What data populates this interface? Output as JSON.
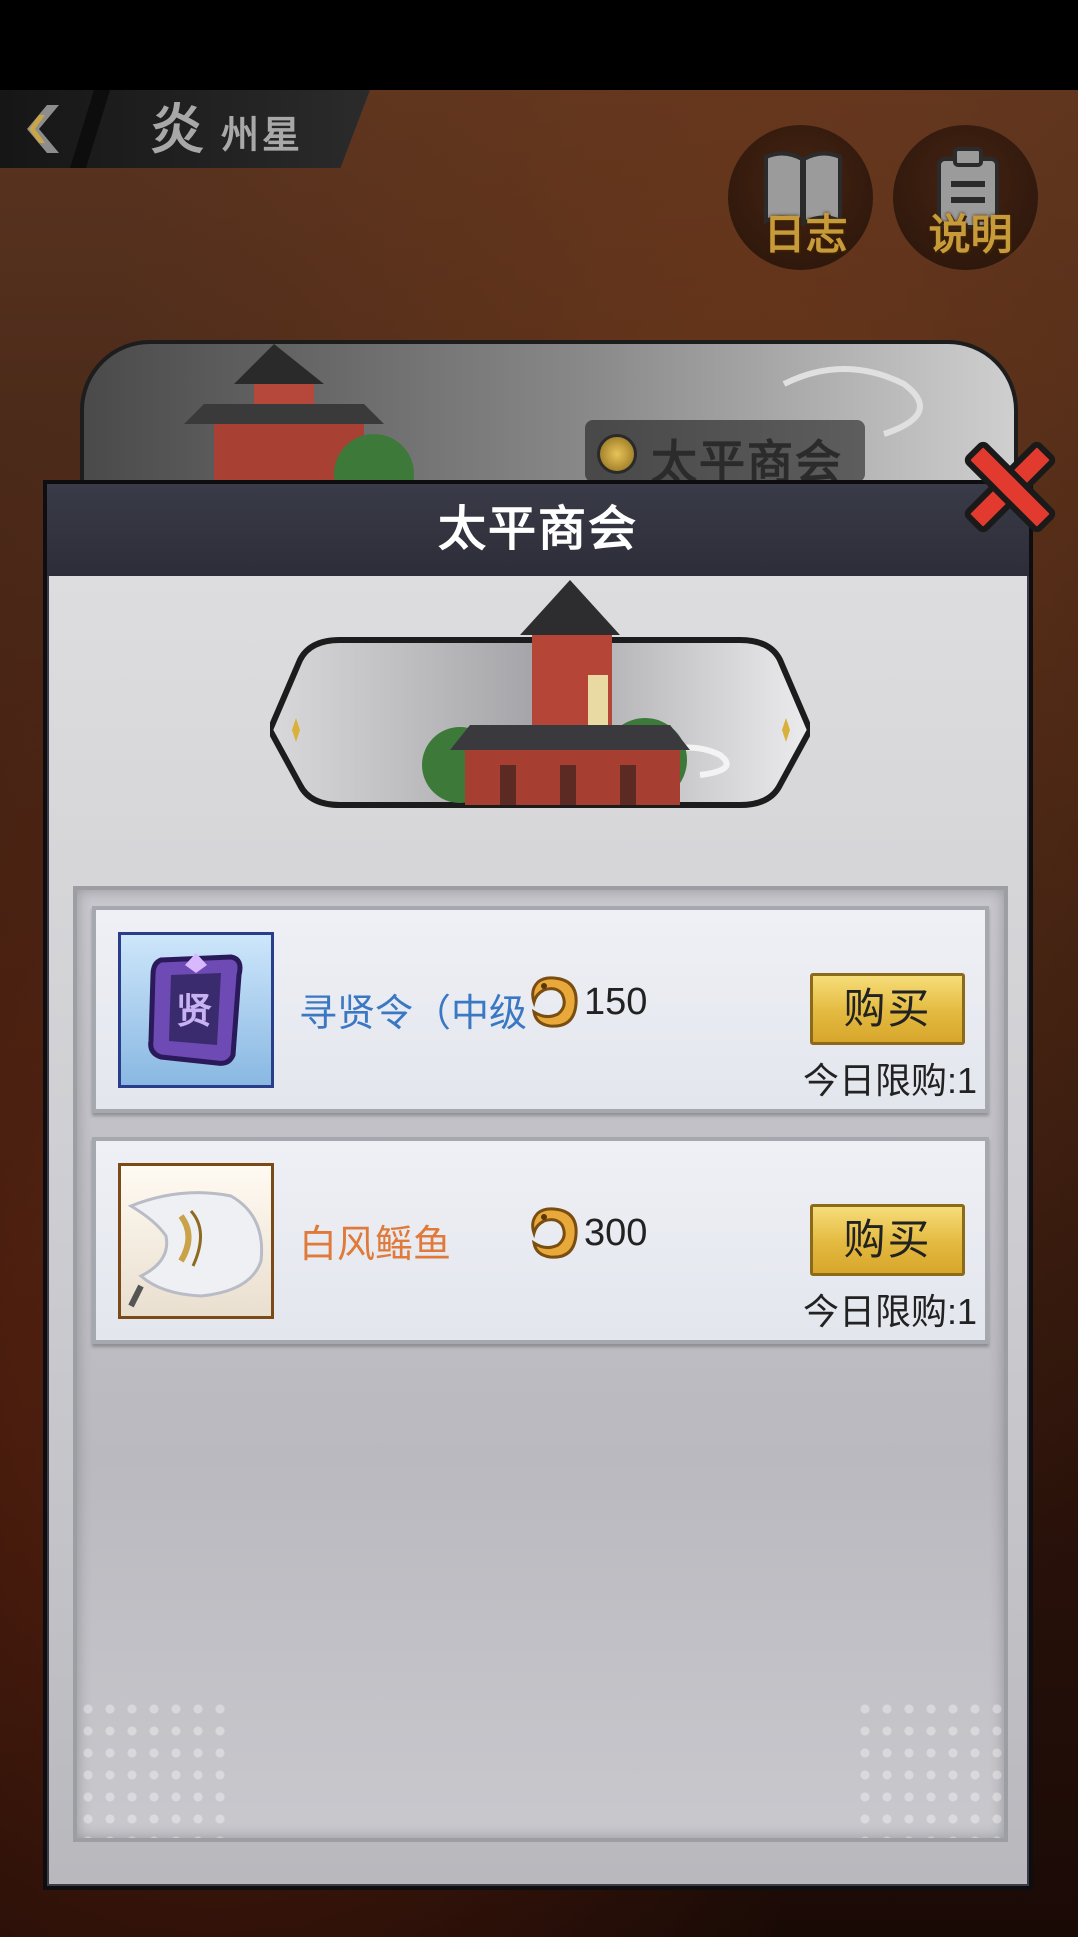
{
  "header": {
    "back_icon": "chevron-left-icon",
    "title_big": "炎",
    "title_small": "州星"
  },
  "side_buttons": [
    {
      "label": "日志",
      "icon": "book-icon"
    },
    {
      "label": "说明",
      "icon": "clipboard-icon"
    }
  ],
  "background_banner": {
    "label": "太平商会"
  },
  "dialog": {
    "title": "太平商会",
    "close_icon": "close-x-icon"
  },
  "items": [
    {
      "name": "寻贤令（中级",
      "name_color": "#3a78c4",
      "icon": "recruit-token-icon",
      "currency_icon": "gold-dragon-coin-icon",
      "price": "150",
      "buy_label": "购买",
      "limit": "今日限购:1"
    },
    {
      "name": "白风鳐鱼",
      "name_color": "#e07a3a",
      "icon": "white-ray-fish-icon",
      "currency_icon": "gold-dragon-coin-icon",
      "price": "300",
      "buy_label": "购买",
      "limit": "今日限购:1"
    }
  ],
  "colors": {
    "buy_button": "#e3b93f",
    "dialog_header": "#2c2d38",
    "close": "#e23a2e"
  }
}
